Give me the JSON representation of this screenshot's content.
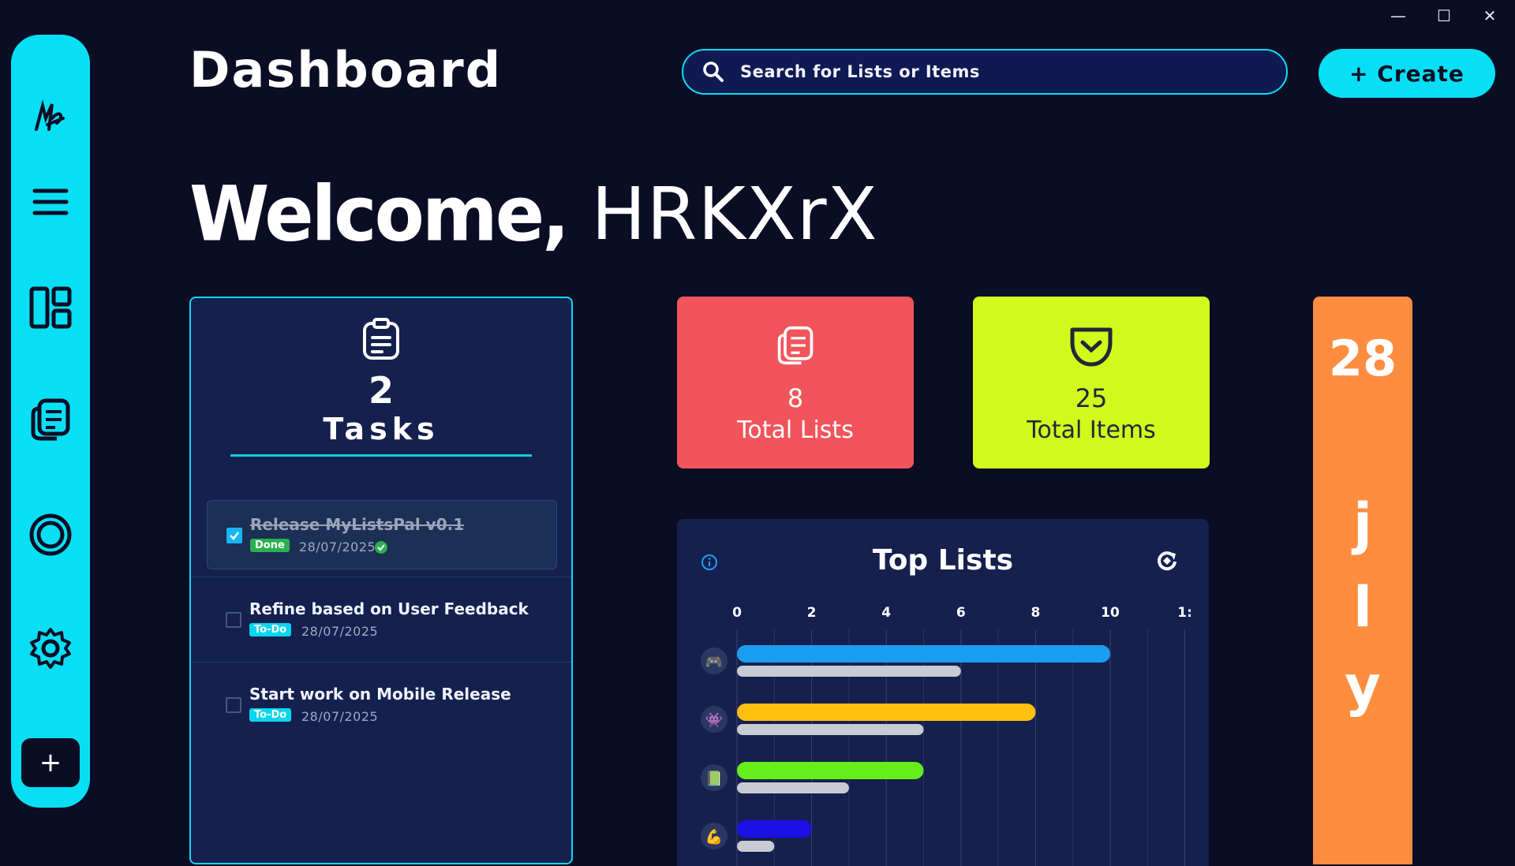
{
  "window": {
    "minimize": "—",
    "maximize": "☐",
    "close": "✕"
  },
  "sidebar": {
    "logo": "logo-icon",
    "items": [
      {
        "icon": "hamburger-menu-icon"
      },
      {
        "icon": "dashboard-layout-icon"
      },
      {
        "icon": "lists-icon"
      },
      {
        "icon": "circle-icon"
      },
      {
        "icon": "settings-gear-icon"
      }
    ],
    "add_label": "+"
  },
  "header": {
    "title": "Dashboard",
    "search_placeholder": "Search for Lists or Items",
    "create_label": "+ Create"
  },
  "welcome": {
    "greeting": "Welcome,",
    "name": " HRKXrX"
  },
  "tasks": {
    "count": "2",
    "label": "Tasks",
    "items": [
      {
        "title": "Release MyListsPal v0.1",
        "status": "Done",
        "date": "28/07/2025",
        "checked": true
      },
      {
        "title": "Refine based on User Feedback",
        "status": "To-Do",
        "date": "28/07/2025",
        "checked": false
      },
      {
        "title": "Start work on Mobile Release",
        "status": "To-Do",
        "date": "28/07/2025",
        "checked": false
      }
    ]
  },
  "stats": {
    "lists": {
      "value": "8",
      "label": "Total Lists",
      "color": "#f1545a"
    },
    "items": {
      "value": "25",
      "label": "Total Items",
      "color": "#d1fa1c"
    }
  },
  "side_card": {
    "number": "28",
    "letters": [
      "j",
      "l",
      "y"
    ],
    "color": "#ff8d40"
  },
  "top_lists": {
    "title": "Top Lists",
    "chart_data": {
      "type": "bar",
      "orientation": "horizontal",
      "title": "Top Lists",
      "xlim": [
        0,
        12
      ],
      "xticks": [
        "0",
        "2",
        "4",
        "6",
        "8",
        "10",
        "1:"
      ],
      "categories": [
        "🎮",
        "👾",
        "📗",
        "💪"
      ],
      "series": [
        {
          "values": [
            10,
            8,
            5,
            2
          ],
          "colors": [
            "#1a9ff0",
            "#ffbf0f",
            "#66ee1a",
            "#1d10e6"
          ]
        },
        {
          "values": [
            6,
            5,
            3,
            1
          ],
          "colors": [
            "#c9cbd4",
            "#c9cbd4",
            "#c9cbd4",
            "#c9cbd4"
          ]
        }
      ],
      "grid": true
    }
  }
}
